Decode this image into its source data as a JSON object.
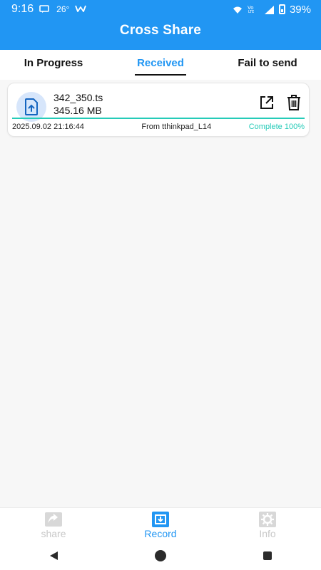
{
  "status_bar": {
    "time": "9:16",
    "temp": "26°",
    "battery": "39%"
  },
  "app_bar": {
    "title": "Cross Share"
  },
  "tabs": [
    {
      "label": "In Progress",
      "active": false
    },
    {
      "label": "Received",
      "active": true
    },
    {
      "label": "Fail to send",
      "active": false
    }
  ],
  "record": {
    "file_name": "342_350.ts",
    "file_size": "345.16 MB",
    "datetime": "2025.09.02 21:16:44",
    "source": "From tthinkpad_L14",
    "status": "Complete 100%",
    "progress": 1.0,
    "icons": {
      "file": "upload-file-icon",
      "open": "open-external-icon",
      "delete": "trash-icon"
    }
  },
  "bottom_nav": [
    {
      "label": "share",
      "icon": "share-icon",
      "active": false
    },
    {
      "label": "Record",
      "icon": "record-icon",
      "active": true
    },
    {
      "label": "Info",
      "icon": "gear-icon",
      "active": false
    }
  ],
  "colors": {
    "primary": "#2196f3",
    "progress": "#25cbb8",
    "inactive": "#c8c8c8"
  }
}
